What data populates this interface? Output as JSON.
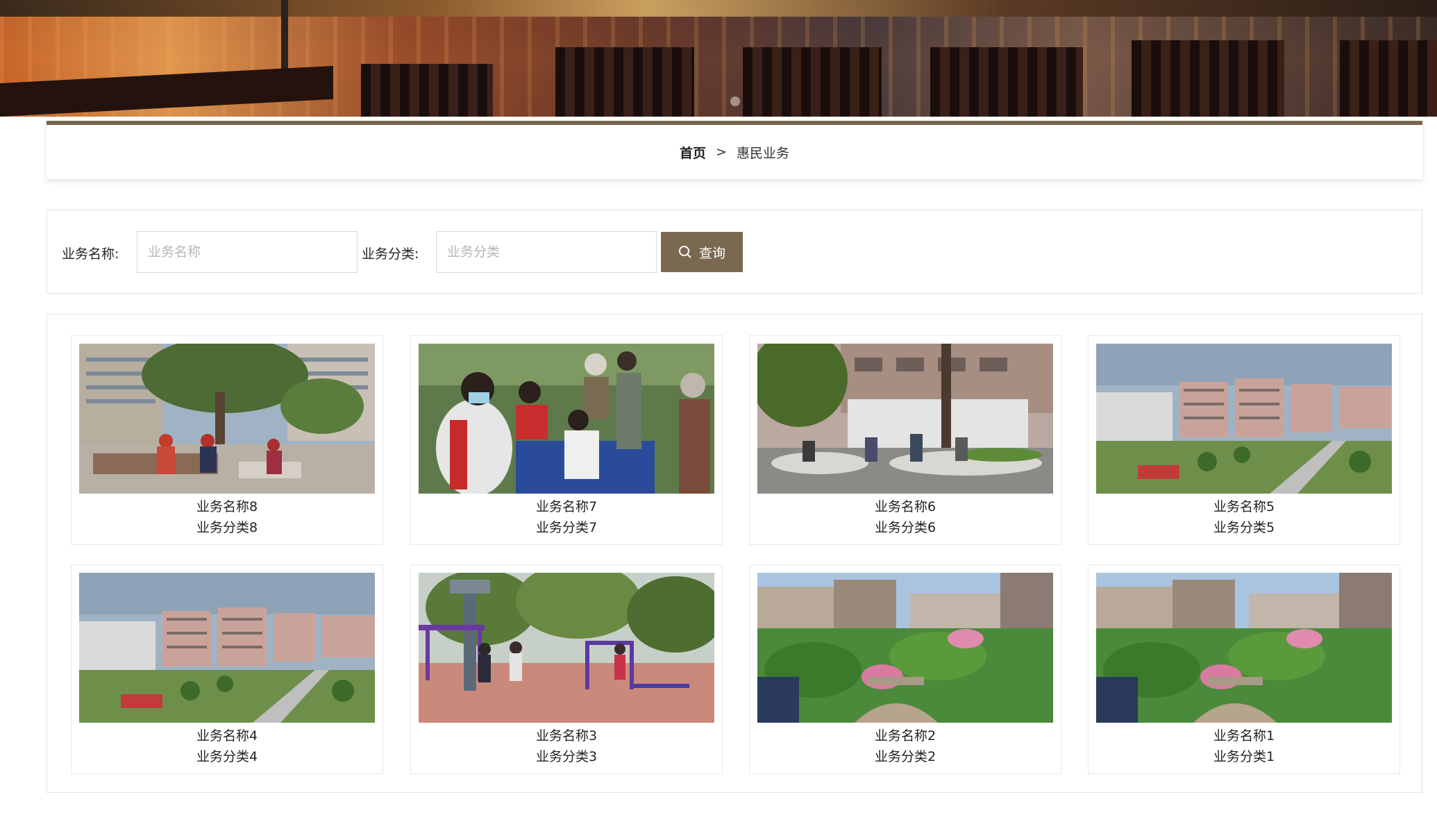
{
  "breadcrumb": {
    "home": "首页",
    "separator": ">",
    "current": "惠民业务"
  },
  "search": {
    "name_label": "业务名称:",
    "name_placeholder": "业务名称",
    "category_label": "业务分类:",
    "category_placeholder": "业务分类",
    "button_label": "查询",
    "button_icon": "search-icon"
  },
  "theme": {
    "accent": "#7b6851",
    "border_top": "#7a664f"
  },
  "items": [
    {
      "name": "业务名称8",
      "category": "业务分类8",
      "image": "park-plaza-residents-photo"
    },
    {
      "name": "业务名称7",
      "category": "业务分类7",
      "image": "volunteer-health-check-photo"
    },
    {
      "name": "业务名称6",
      "category": "业务分类6",
      "image": "courtyard-seating-photo"
    },
    {
      "name": "业务名称5",
      "category": "业务分类5",
      "image": "residential-aerial-photo"
    },
    {
      "name": "业务名称4",
      "category": "业务分类4",
      "image": "residential-aerial-photo"
    },
    {
      "name": "业务名称3",
      "category": "业务分类3",
      "image": "fitness-equipment-photo"
    },
    {
      "name": "业务名称2",
      "category": "业务分类2",
      "image": "garden-rendering-photo"
    },
    {
      "name": "业务名称1",
      "category": "业务分类1",
      "image": "garden-rendering-photo"
    }
  ]
}
